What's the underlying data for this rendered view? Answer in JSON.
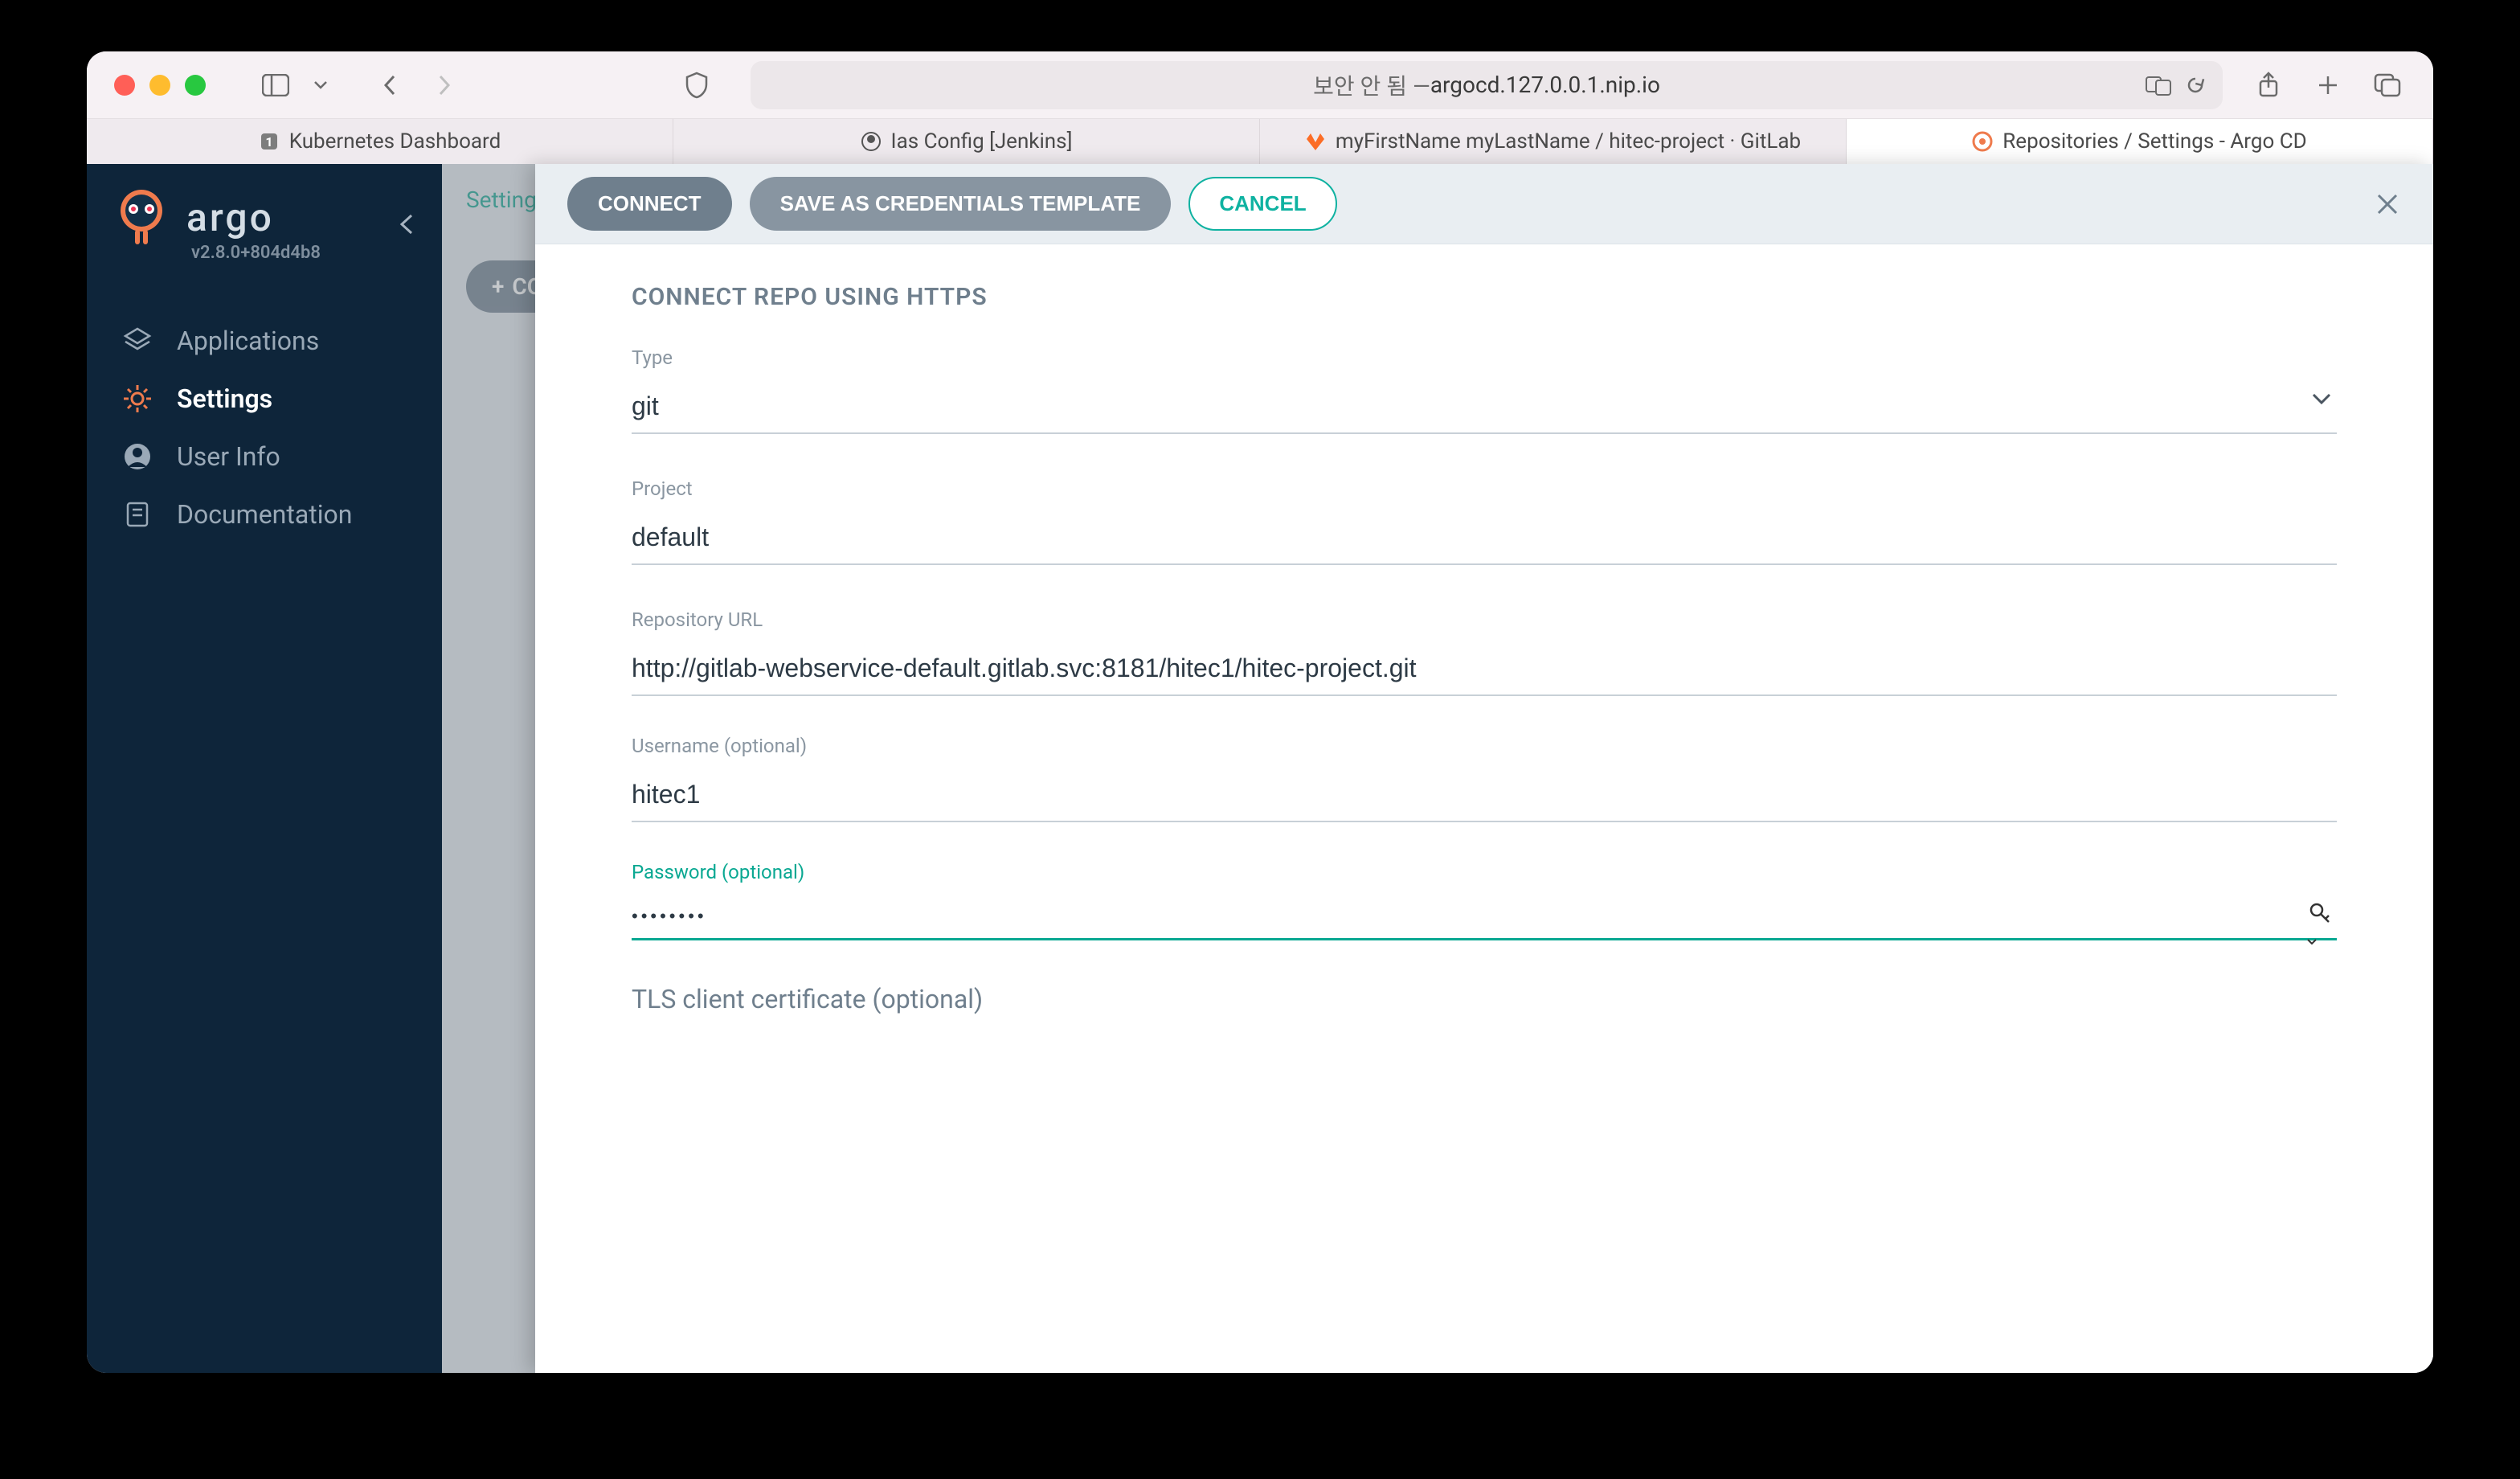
{
  "browser": {
    "url_prefix": "보안 안 됨 — ",
    "url_host": "argocd.127.0.0.1.nip.io",
    "tabs": [
      {
        "label": "Kubernetes Dashboard",
        "icon": "k8s"
      },
      {
        "label": "Ias Config [Jenkins]",
        "icon": "jenkins"
      },
      {
        "label": "myFirstName myLastName / hitec-project · GitLab",
        "icon": "gitlab"
      },
      {
        "label": "Repositories / Settings - Argo CD",
        "icon": "argo",
        "active": true
      }
    ]
  },
  "sidebar": {
    "brand": "argo",
    "version": "v2.8.0+804d4b8",
    "items": [
      {
        "id": "applications",
        "label": "Applications"
      },
      {
        "id": "settings",
        "label": "Settings",
        "active": true
      },
      {
        "id": "user-info",
        "label": "User Info"
      },
      {
        "id": "documentation",
        "label": "Documentation"
      }
    ]
  },
  "back": {
    "breadcrumb": "Settings",
    "add_button_fragment": "CO"
  },
  "panel": {
    "buttons": {
      "connect": "CONNECT",
      "save_template": "SAVE AS CREDENTIALS TEMPLATE",
      "cancel": "CANCEL"
    },
    "section_title": "CONNECT REPO USING HTTPS",
    "fields": {
      "type": {
        "label": "Type",
        "value": "git"
      },
      "project": {
        "label": "Project",
        "value": "default"
      },
      "repo_url": {
        "label": "Repository URL",
        "value": "http://gitlab-webservice-default.gitlab.svc:8181/hitec1/hitec-project.git"
      },
      "username": {
        "label": "Username (optional)",
        "value": "hitec1"
      },
      "password": {
        "label": "Password (optional)",
        "value": "••••••••"
      }
    },
    "tls_title": "TLS client certificate (optional)"
  }
}
